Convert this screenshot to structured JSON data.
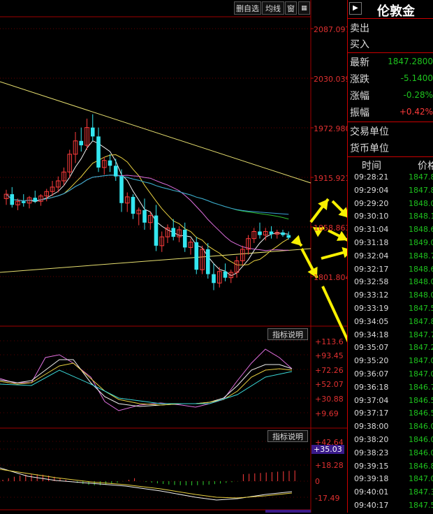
{
  "toolbar": {
    "buttons": [
      "删自选",
      "均线",
      "窗"
    ]
  },
  "main_axis": [
    "2087.097",
    "2030.039",
    "1972.980",
    "1915.921",
    "1858.863",
    "1801.804"
  ],
  "osc_axis": [
    "+113.6",
    "+93.45",
    "+72.26",
    "+52.07",
    "+30.88",
    "+9.69"
  ],
  "macd_axis": [
    "+42.64",
    "+35.03",
    "+18.28",
    "0",
    "-17.49"
  ],
  "indicator_label": "指标说明",
  "quote": {
    "title": "伦敦金",
    "sell_label": "卖出",
    "buy_label": "买入",
    "latest_label": "最新",
    "latest_value": "1847.2800",
    "change_label": "涨跌",
    "change_value": "-5.1400",
    "pct_label": "涨幅",
    "pct_value": "-0.28%",
    "amp_label": "振幅",
    "amp_value": "+0.42%",
    "unit_label": "交易单位",
    "currency_label": "货币单位"
  },
  "ticks_header": {
    "time": "时间",
    "price": "价格"
  },
  "ticks": [
    {
      "time": "09:28:21",
      "price": "1847.8"
    },
    {
      "time": "09:29:04",
      "price": "1847.8"
    },
    {
      "time": "09:29:20",
      "price": "1848.0"
    },
    {
      "time": "09:30:10",
      "price": "1848.1"
    },
    {
      "time": "09:31:04",
      "price": "1848.6"
    },
    {
      "time": "09:31:18",
      "price": "1849.0"
    },
    {
      "time": "09:32:04",
      "price": "1848.7"
    },
    {
      "time": "09:32:17",
      "price": "1848.6"
    },
    {
      "time": "09:32:58",
      "price": "1848.0"
    },
    {
      "time": "09:33:12",
      "price": "1848.0"
    },
    {
      "time": "09:33:19",
      "price": "1847.5"
    },
    {
      "time": "09:34:05",
      "price": "1847.8"
    },
    {
      "time": "09:34:18",
      "price": "1847.7"
    },
    {
      "time": "09:35:07",
      "price": "1847.2"
    },
    {
      "time": "09:35:20",
      "price": "1847.0"
    },
    {
      "time": "09:36:07",
      "price": "1847.0"
    },
    {
      "time": "09:36:18",
      "price": "1846.7"
    },
    {
      "time": "09:37:04",
      "price": "1846.5"
    },
    {
      "time": "09:37:17",
      "price": "1846.5"
    },
    {
      "time": "09:38:00",
      "price": "1846.0"
    },
    {
      "time": "09:38:20",
      "price": "1846.0"
    },
    {
      "time": "09:38:23",
      "price": "1846.0"
    },
    {
      "time": "09:39:15",
      "price": "1846.8"
    },
    {
      "time": "09:39:18",
      "price": "1847.0"
    },
    {
      "time": "09:40:01",
      "price": "1847.3"
    },
    {
      "time": "09:40:17",
      "price": "1847.5"
    }
  ],
  "chart_data": {
    "type": "candlestick",
    "price_range": [
      1790,
      2095
    ],
    "candles": [
      {
        "o": 1895,
        "h": 1905,
        "l": 1888,
        "c": 1900,
        "up": true
      },
      {
        "o": 1900,
        "h": 1908,
        "l": 1885,
        "c": 1888,
        "up": false
      },
      {
        "o": 1888,
        "h": 1895,
        "l": 1882,
        "c": 1892,
        "up": true
      },
      {
        "o": 1892,
        "h": 1900,
        "l": 1886,
        "c": 1890,
        "up": false
      },
      {
        "o": 1890,
        "h": 1898,
        "l": 1884,
        "c": 1896,
        "up": true
      },
      {
        "o": 1896,
        "h": 1904,
        "l": 1890,
        "c": 1892,
        "up": false
      },
      {
        "o": 1892,
        "h": 1900,
        "l": 1887,
        "c": 1898,
        "up": true
      },
      {
        "o": 1898,
        "h": 1906,
        "l": 1892,
        "c": 1903,
        "up": true
      },
      {
        "o": 1903,
        "h": 1915,
        "l": 1898,
        "c": 1908,
        "up": true
      },
      {
        "o": 1908,
        "h": 1920,
        "l": 1902,
        "c": 1915,
        "up": true
      },
      {
        "o": 1915,
        "h": 1930,
        "l": 1910,
        "c": 1925,
        "up": true
      },
      {
        "o": 1925,
        "h": 1950,
        "l": 1918,
        "c": 1945,
        "up": true
      },
      {
        "o": 1945,
        "h": 1970,
        "l": 1935,
        "c": 1960,
        "up": true
      },
      {
        "o": 1960,
        "h": 1975,
        "l": 1948,
        "c": 1955,
        "up": false
      },
      {
        "o": 1955,
        "h": 1985,
        "l": 1950,
        "c": 1975,
        "up": true
      },
      {
        "o": 1975,
        "h": 1990,
        "l": 1960,
        "c": 1965,
        "up": false
      },
      {
        "o": 1965,
        "h": 1975,
        "l": 1925,
        "c": 1930,
        "up": false
      },
      {
        "o": 1930,
        "h": 1942,
        "l": 1922,
        "c": 1938,
        "up": true
      },
      {
        "o": 1938,
        "h": 1945,
        "l": 1925,
        "c": 1932,
        "up": false
      },
      {
        "o": 1932,
        "h": 1940,
        "l": 1915,
        "c": 1920,
        "up": false
      },
      {
        "o": 1920,
        "h": 1928,
        "l": 1880,
        "c": 1890,
        "up": false
      },
      {
        "o": 1890,
        "h": 1902,
        "l": 1880,
        "c": 1897,
        "up": true
      },
      {
        "o": 1897,
        "h": 1900,
        "l": 1872,
        "c": 1878,
        "up": false
      },
      {
        "o": 1878,
        "h": 1885,
        "l": 1865,
        "c": 1882,
        "up": true
      },
      {
        "o": 1882,
        "h": 1895,
        "l": 1860,
        "c": 1868,
        "up": false
      },
      {
        "o": 1868,
        "h": 1880,
        "l": 1860,
        "c": 1876,
        "up": true
      },
      {
        "o": 1876,
        "h": 1888,
        "l": 1836,
        "c": 1842,
        "up": false
      },
      {
        "o": 1842,
        "h": 1858,
        "l": 1835,
        "c": 1852,
        "up": true
      },
      {
        "o": 1852,
        "h": 1866,
        "l": 1845,
        "c": 1862,
        "up": true
      },
      {
        "o": 1862,
        "h": 1872,
        "l": 1848,
        "c": 1852,
        "up": false
      },
      {
        "o": 1852,
        "h": 1864,
        "l": 1846,
        "c": 1860,
        "up": true
      },
      {
        "o": 1860,
        "h": 1868,
        "l": 1835,
        "c": 1840,
        "up": false
      },
      {
        "o": 1840,
        "h": 1850,
        "l": 1832,
        "c": 1846,
        "up": true
      },
      {
        "o": 1846,
        "h": 1852,
        "l": 1810,
        "c": 1815,
        "up": false
      },
      {
        "o": 1815,
        "h": 1842,
        "l": 1810,
        "c": 1838,
        "up": true
      },
      {
        "o": 1838,
        "h": 1845,
        "l": 1805,
        "c": 1810,
        "up": false
      },
      {
        "o": 1810,
        "h": 1822,
        "l": 1792,
        "c": 1800,
        "up": false
      },
      {
        "o": 1800,
        "h": 1818,
        "l": 1795,
        "c": 1813,
        "up": true
      },
      {
        "o": 1813,
        "h": 1822,
        "l": 1802,
        "c": 1806,
        "up": false
      },
      {
        "o": 1806,
        "h": 1815,
        "l": 1800,
        "c": 1812,
        "up": true
      },
      {
        "o": 1812,
        "h": 1830,
        "l": 1806,
        "c": 1825,
        "up": true
      },
      {
        "o": 1825,
        "h": 1842,
        "l": 1820,
        "c": 1838,
        "up": true
      },
      {
        "o": 1838,
        "h": 1854,
        "l": 1832,
        "c": 1850,
        "up": true
      },
      {
        "o": 1850,
        "h": 1862,
        "l": 1845,
        "c": 1858,
        "up": true
      },
      {
        "o": 1858,
        "h": 1868,
        "l": 1850,
        "c": 1854,
        "up": false
      },
      {
        "o": 1854,
        "h": 1862,
        "l": 1848,
        "c": 1858,
        "up": true
      },
      {
        "o": 1858,
        "h": 1864,
        "l": 1850,
        "c": 1855,
        "up": false
      },
      {
        "o": 1855,
        "h": 1860,
        "l": 1850,
        "c": 1857,
        "up": true
      },
      {
        "o": 1857,
        "h": 1860,
        "l": 1852,
        "c": 1854,
        "up": false
      },
      {
        "o": 1854,
        "h": 1858,
        "l": 1849,
        "c": 1851,
        "up": false
      }
    ]
  }
}
